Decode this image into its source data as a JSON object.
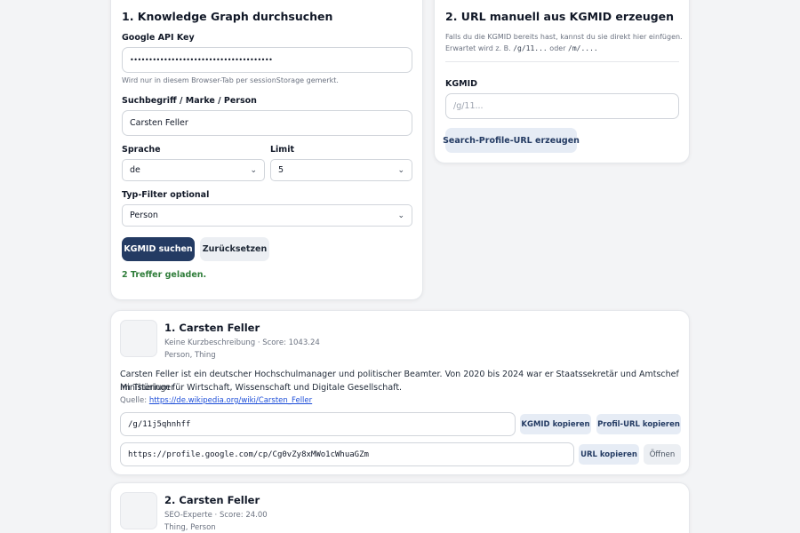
{
  "search": {
    "title": "1. Knowledge Graph durchsuchen",
    "api_key_label": "Google API Key",
    "api_key_value": "••••••••••••••••••••••••••••••••••••••",
    "api_key_hint": "Wird nur in diesem Browser-Tab per sessionStorage gemerkt.",
    "query_label": "Suchbegriff / Marke / Person",
    "query_value": "Carsten Feller",
    "language_label": "Sprache",
    "language_value": "de",
    "limit_label": "Limit",
    "limit_value": "5",
    "type_label": "Typ-Filter optional",
    "type_value": "Person",
    "search_button": "KGMID suchen",
    "reset_button": "Zurücksetzen",
    "status": "2 Treffer geladen."
  },
  "manual": {
    "title": "2. URL manuell aus KGMID erzeugen",
    "hint_line1": "Falls du die KGMID bereits hast, kannst du sie direkt hier einfügen.",
    "hint_line2_prefix": "Erwartet wird z. B.",
    "hint_code1": "/g/11...",
    "hint_or": "oder",
    "hint_code2": "/m/....",
    "kgmid_label": "KGMID",
    "kgmid_placeholder": "/g/11...",
    "generate_button": "Search-Profile-URL erzeugen"
  },
  "results": [
    {
      "title": "1. Carsten Feller",
      "meta": "Keine Kurzbeschreibung · Score: 1043.24",
      "types": "Person, Thing",
      "description_line1": "Carsten Feller ist ein deutscher Hochschulmanager und politischer Beamter. Von 2020 bis 2024 war er Staatssekretär und Amtschef im Thüringer",
      "description_line2": "Ministerium für Wirtschaft, Wissenschaft und Digitale Gesellschaft.",
      "source_label": "Quelle:",
      "source_url": "https://de.wikipedia.org/wiki/Carsten_Feller",
      "kgmid": "/g/11j5qhnhff",
      "copy_kgmid": "KGMID kopieren",
      "copy_profile": "Profil-URL kopieren",
      "profile_url": "https://profile.google.com/cp/Cg0vZy8xMWo1cWhuaGZm",
      "copy_url": "URL kopieren",
      "open": "Öffnen"
    },
    {
      "title": "2. Carsten Feller",
      "meta": "SEO-Experte · Score: 24.00",
      "types": "Thing, Person"
    }
  ]
}
